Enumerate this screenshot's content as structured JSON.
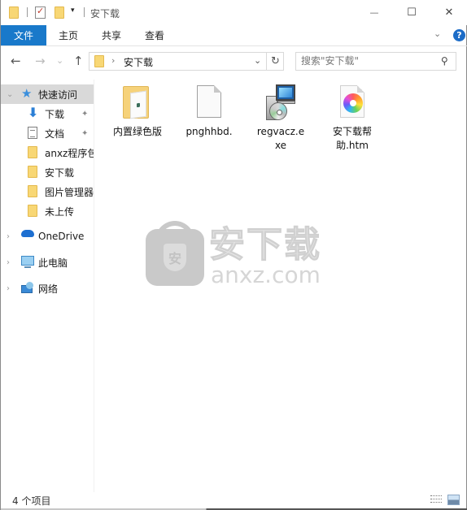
{
  "window": {
    "title": "安下载",
    "controls": {
      "minimize": "—",
      "maximize": "☐",
      "close": "✕"
    }
  },
  "quick_access_toolbar": {
    "icons": [
      "folder-icon",
      "properties-icon",
      "new-folder-icon"
    ],
    "dropdown": "▾"
  },
  "ribbon": {
    "tabs": [
      {
        "label": "文件",
        "active": true
      },
      {
        "label": "主页"
      },
      {
        "label": "共享"
      },
      {
        "label": "查看"
      }
    ],
    "expand_glyph": "⌄",
    "help_glyph": "?"
  },
  "navigation": {
    "back": "←",
    "forward": "→",
    "recent": "⌄",
    "up": "↑",
    "address": {
      "separator": "›",
      "path": "安下载",
      "dropdown": "⌄",
      "refresh": "↻"
    },
    "search": {
      "placeholder": "搜索\"安下载\"",
      "value": "",
      "icon": "⚲"
    }
  },
  "sidebar": {
    "quick_access": {
      "label": "快速访问",
      "expander": "⌄",
      "icon": "★"
    },
    "pinned": [
      {
        "label": "下载",
        "icon": "download-icon",
        "pinned": true
      },
      {
        "label": "文档",
        "icon": "document-icon",
        "pinned": true
      },
      {
        "label": "anxz程序包",
        "icon": "folder-icon"
      },
      {
        "label": "安下载",
        "icon": "folder-icon"
      },
      {
        "label": "图片管理器",
        "icon": "folder-icon"
      },
      {
        "label": "未上传",
        "icon": "folder-icon"
      }
    ],
    "roots": [
      {
        "label": "OneDrive",
        "expander": "›",
        "icon": "onedrive-icon"
      },
      {
        "label": "此电脑",
        "expander": "›",
        "icon": "this-pc-icon"
      },
      {
        "label": "网络",
        "expander": "›",
        "icon": "network-icon"
      }
    ],
    "pin_glyph": "📌",
    "down_glyph": "⬇"
  },
  "files": [
    {
      "name": "内置绿色版",
      "type": "folder"
    },
    {
      "name": "pnghhbd.",
      "type": "file"
    },
    {
      "name": "regvacz.exe",
      "type": "installer"
    },
    {
      "name": "安下载帮助.htm",
      "type": "html"
    }
  ],
  "watermark": {
    "cn": "安下载",
    "en": "anxz.com",
    "shield_char": "安"
  },
  "status": {
    "item_count": "4 个项目"
  },
  "colors": {
    "file_tab": "#1979ca",
    "selected_nav": "#d9d9d9",
    "folder": "#f8d775"
  }
}
